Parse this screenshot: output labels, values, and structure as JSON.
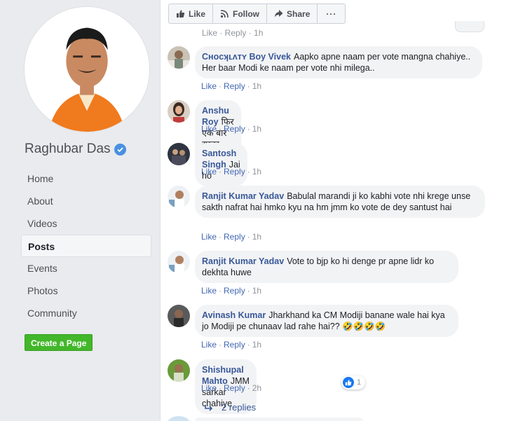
{
  "page": {
    "name": "Raghubar Das",
    "verified_icon": "verified-check-icon"
  },
  "nav": {
    "items": [
      {
        "label": "Home"
      },
      {
        "label": "About"
      },
      {
        "label": "Videos"
      },
      {
        "label": "Posts"
      },
      {
        "label": "Events"
      },
      {
        "label": "Photos"
      },
      {
        "label": "Community"
      }
    ],
    "active": "Posts"
  },
  "create_page_label": "Create a Page",
  "actions": {
    "like": "Like",
    "follow": "Follow",
    "share": "Share",
    "more": "···"
  },
  "clipped_meta": "Like · Reply · 1h",
  "comments": [
    {
      "author": "Cʜᴏᴄʞʟᴧᴛʏ Boy Vivek",
      "text": "Aapko apne naam per vote mangna chahiye.. Her baar Modi ke naam per vote nhi milega..",
      "like": "Like",
      "reply": "Reply",
      "time": "1h"
    },
    {
      "author": "Anshu Roy",
      "text": "फिर एक बार रघुबर सरकार !@!",
      "like": "Like",
      "reply": "Reply",
      "time": "1h"
    },
    {
      "author": "Santosh Singh",
      "text": "Jai ho",
      "like": "Like",
      "reply": "Reply",
      "time": "1h"
    },
    {
      "author": "Ranjit Kumar Yadav",
      "text": "Babulal marandi ji ko kabhi vote nhi krege unse sakth nafrat hai hmko kyu na hm jmm ko vote de dey santust hai",
      "like": "Like",
      "reply": "Reply",
      "time": "1h"
    },
    {
      "author": "Ranjit Kumar Yadav",
      "text": "Vote to bjp ko hi denge pr apne lidr ko dekhta huwe",
      "like": "Like",
      "reply": "Reply",
      "time": "1h"
    },
    {
      "author": "Avinash Kumar",
      "text": "Jharkhand ka CM Modiji banane wale hai kya jo Modiji pe chunaav lad rahe hai?? 🤣🤣🤣🤣",
      "like": "Like",
      "reply": "Reply",
      "time": "1h"
    },
    {
      "author": "Shishupal Mahto",
      "text": "JMM sarkar chahiye",
      "like": "Like",
      "reply": "Reply",
      "time": "2h",
      "reaction_count": "1"
    }
  ],
  "replies_link": "2 replies",
  "colors": {
    "link_blue": "#385898",
    "meta_blue": "#4267b2",
    "create_green": "#42b72a",
    "bubble_bg": "#f2f3f5"
  }
}
